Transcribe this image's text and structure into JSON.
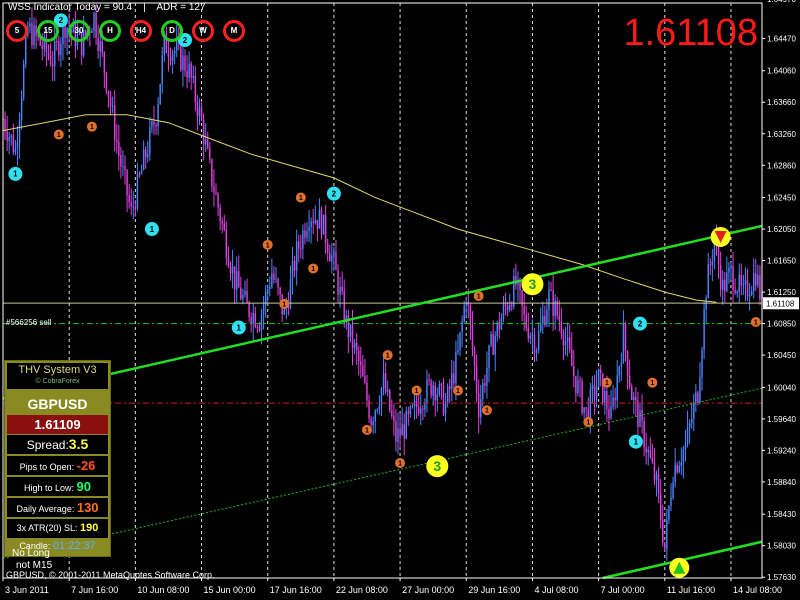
{
  "header": {
    "indicator_text": "WSS Indicator Today = 90.4",
    "separator": "|",
    "adr_text": "ADR = 127"
  },
  "timeframes": [
    {
      "label": "5",
      "color": "#ff2020"
    },
    {
      "label": "15",
      "color": "#20d020"
    },
    {
      "label": "30",
      "color": "#20d020"
    },
    {
      "label": "H",
      "color": "#20d020"
    },
    {
      "label": "H4",
      "color": "#ff2020"
    },
    {
      "label": "D",
      "color": "#20d020"
    },
    {
      "label": "W",
      "color": "#ff2020"
    },
    {
      "label": "M",
      "color": "#ff2020"
    }
  ],
  "big_price": "1.61108",
  "order_label": "#566256 sell",
  "current_price_tag": "1.61108",
  "panel": {
    "title": "THV System V3",
    "subtitle": "© CobraForex",
    "symbol": "GBPUSD",
    "price": "1.61109",
    "spread_label": "Spread:",
    "spread_value": "3.5",
    "pips_label": "Pips to Open:",
    "pips_value": "-26",
    "htl_label": "High to Low:",
    "htl_value": "90",
    "daily_label": "Daily Average:",
    "daily_value": "130",
    "atr_label": "3x ATR(20) SL:",
    "atr_value": "190",
    "candle_label": "Candle:",
    "candle_value": "01:22:37"
  },
  "overlay_text": {
    "line1": "No Long",
    "line2": "not M15"
  },
  "copyright": "GBPUSD, © 2001-2011 MetaQuotes Software Corp.",
  "chart_data": {
    "type": "candlestick",
    "symbol": "GBPUSD",
    "ylim": [
      1.5762,
      1.6492
    ],
    "y_ticks": [
      "1.64970",
      "1.64470",
      "1.64060",
      "1.63660",
      "1.63260",
      "1.62860",
      "1.62450",
      "1.62050",
      "1.61650",
      "1.61250",
      "1.60850",
      "1.60450",
      "1.60040",
      "1.59640",
      "1.59240",
      "1.58840",
      "1.58430",
      "1.58030",
      "1.57630"
    ],
    "x_tick_labels": [
      "3 Jun 2011",
      "7 Jun 16:00",
      "10 Jun 08:00",
      "15 Jun 00:00",
      "17 Jun 16:00",
      "22 Jun 08:00",
      "27 Jun 00:00",
      "29 Jun 16:00",
      "4 Jul 08:00",
      "7 Jul 00:00",
      "11 Jul 16:00",
      "14 Jul 08:00"
    ],
    "x_tick_positions": [
      0,
      32,
      64,
      96,
      128,
      160,
      192,
      224,
      256,
      288,
      320,
      352
    ],
    "bar_count": 368,
    "close_path": [
      [
        0,
        1.6345
      ],
      [
        6,
        1.6305
      ],
      [
        12,
        1.646
      ],
      [
        18,
        1.644
      ],
      [
        24,
        1.642
      ],
      [
        30,
        1.6465
      ],
      [
        38,
        1.644
      ],
      [
        44,
        1.6475
      ],
      [
        50,
        1.6395
      ],
      [
        56,
        1.63
      ],
      [
        62,
        1.6225
      ],
      [
        68,
        1.629
      ],
      [
        74,
        1.635
      ],
      [
        78,
        1.644
      ],
      [
        84,
        1.643
      ],
      [
        90,
        1.6405
      ],
      [
        96,
        1.634
      ],
      [
        100,
        1.628
      ],
      [
        106,
        1.621
      ],
      [
        112,
        1.614
      ],
      [
        118,
        1.6105
      ],
      [
        124,
        1.609
      ],
      [
        130,
        1.615
      ],
      [
        136,
        1.6095
      ],
      [
        142,
        1.6175
      ],
      [
        148,
        1.6225
      ],
      [
        154,
        1.6215
      ],
      [
        160,
        1.616
      ],
      [
        166,
        1.6085
      ],
      [
        172,
        1.6035
      ],
      [
        178,
        1.5965
      ],
      [
        184,
        1.601
      ],
      [
        190,
        1.594
      ],
      [
        196,
        1.596
      ],
      [
        202,
        1.599
      ],
      [
        208,
        1.601
      ],
      [
        214,
        1.598
      ],
      [
        220,
        1.6045
      ],
      [
        224,
        1.6125
      ],
      [
        230,
        1.598
      ],
      [
        236,
        1.6055
      ],
      [
        242,
        1.61
      ],
      [
        248,
        1.6135
      ],
      [
        252,
        1.609
      ],
      [
        258,
        1.606
      ],
      [
        264,
        1.612
      ],
      [
        270,
        1.6085
      ],
      [
        276,
        1.602
      ],
      [
        282,
        1.597
      ],
      [
        288,
        1.6015
      ],
      [
        294,
        1.5965
      ],
      [
        300,
        1.607
      ],
      [
        304,
        1.5995
      ],
      [
        310,
        1.594
      ],
      [
        316,
        1.588
      ],
      [
        320,
        1.58
      ],
      [
        324,
        1.59
      ],
      [
        330,
        1.593
      ],
      [
        336,
        1.6
      ],
      [
        340,
        1.613
      ],
      [
        344,
        1.619
      ],
      [
        348,
        1.613
      ],
      [
        352,
        1.615
      ],
      [
        358,
        1.612
      ],
      [
        364,
        1.615
      ],
      [
        367,
        1.6111
      ]
    ],
    "ma_path": [
      [
        0,
        1.633
      ],
      [
        20,
        1.634
      ],
      [
        40,
        1.635
      ],
      [
        60,
        1.635
      ],
      [
        80,
        1.634
      ],
      [
        100,
        1.632
      ],
      [
        120,
        1.63
      ],
      [
        140,
        1.6285
      ],
      [
        160,
        1.627
      ],
      [
        180,
        1.6245
      ],
      [
        200,
        1.6225
      ],
      [
        220,
        1.6205
      ],
      [
        240,
        1.619
      ],
      [
        260,
        1.6175
      ],
      [
        280,
        1.616
      ],
      [
        300,
        1.6142
      ],
      [
        320,
        1.6125
      ],
      [
        335,
        1.6115
      ],
      [
        345,
        1.6112
      ]
    ],
    "channel_upper": [
      [
        0,
        1.599
      ],
      [
        367,
        1.6209
      ]
    ],
    "channel_mid": [
      [
        0,
        1.5787
      ],
      [
        367,
        1.6003
      ]
    ],
    "channel_lower": [
      [
        290,
        1.5762
      ],
      [
        367,
        1.5808
      ]
    ],
    "hlines": [
      {
        "y": 1.6111,
        "color": "#c8c8a0",
        "dash": false
      },
      {
        "y": 1.6085,
        "color": "#20c020",
        "dash": true
      },
      {
        "y": 1.5984,
        "color": "#d02020",
        "dash": true
      }
    ],
    "vlines_at": [
      32,
      64,
      96,
      128,
      160,
      192,
      224,
      256,
      288,
      320,
      352
    ],
    "markers": [
      {
        "x": 6,
        "y": 1.6275,
        "label": "1",
        "type": "cyan"
      },
      {
        "x": 28,
        "y": 1.647,
        "label": "2",
        "type": "cyan"
      },
      {
        "x": 27,
        "y": 1.6325,
        "label": "1",
        "type": "orange"
      },
      {
        "x": 43,
        "y": 1.6335,
        "label": "1",
        "type": "orange"
      },
      {
        "x": 72,
        "y": 1.6205,
        "label": "1",
        "type": "cyan"
      },
      {
        "x": 88,
        "y": 1.6445,
        "label": "2",
        "type": "cyan"
      },
      {
        "x": 114,
        "y": 1.608,
        "label": "1",
        "type": "cyan"
      },
      {
        "x": 128,
        "y": 1.6185,
        "label": "1",
        "type": "orange"
      },
      {
        "x": 136,
        "y": 1.611,
        "label": "1",
        "type": "orange"
      },
      {
        "x": 144,
        "y": 1.6245,
        "label": "1",
        "type": "orange"
      },
      {
        "x": 150,
        "y": 1.6155,
        "label": "1",
        "type": "orange"
      },
      {
        "x": 160,
        "y": 1.625,
        "label": "2",
        "type": "cyan"
      },
      {
        "x": 176,
        "y": 1.595,
        "label": "1",
        "type": "orange"
      },
      {
        "x": 186,
        "y": 1.6045,
        "label": "1",
        "type": "orange"
      },
      {
        "x": 192,
        "y": 1.5908,
        "label": "1",
        "type": "orange"
      },
      {
        "x": 200,
        "y": 1.6,
        "label": "1",
        "type": "orange"
      },
      {
        "x": 210,
        "y": 1.5904,
        "label": "3",
        "type": "yellow"
      },
      {
        "x": 220,
        "y": 1.6,
        "label": "1",
        "type": "orange"
      },
      {
        "x": 230,
        "y": 1.612,
        "label": "1",
        "type": "orange"
      },
      {
        "x": 234,
        "y": 1.5975,
        "label": "1",
        "type": "orange"
      },
      {
        "x": 256,
        "y": 1.6135,
        "label": "3",
        "type": "yellow"
      },
      {
        "x": 283,
        "y": 1.596,
        "label": "1",
        "type": "orange"
      },
      {
        "x": 292,
        "y": 1.601,
        "label": "1",
        "type": "orange"
      },
      {
        "x": 306,
        "y": 1.5935,
        "label": "1",
        "type": "cyan"
      },
      {
        "x": 308,
        "y": 1.6085,
        "label": "2",
        "type": "cyan"
      },
      {
        "x": 314,
        "y": 1.601,
        "label": "1",
        "type": "orange"
      },
      {
        "x": 347,
        "y": 1.6195,
        "label": "sell",
        "type": "sell"
      },
      {
        "x": 327,
        "y": 1.5775,
        "label": "buy",
        "type": "buy"
      },
      {
        "x": 364,
        "y": 1.6087,
        "label": "1",
        "type": "orange"
      }
    ]
  }
}
